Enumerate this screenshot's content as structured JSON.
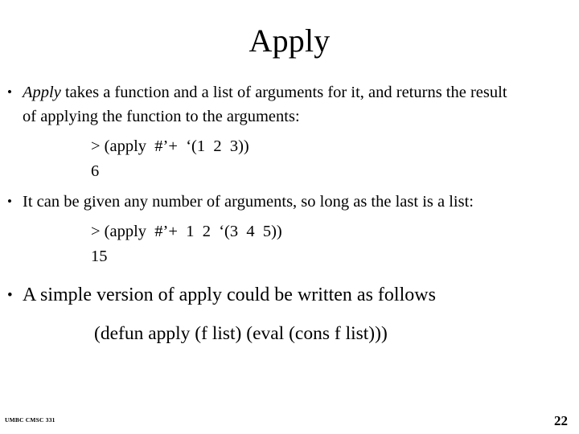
{
  "slide": {
    "title": "Apply",
    "bullets": [
      {
        "id": "bullet-apply-description",
        "lead_italic": "Apply",
        "text": " takes a function and a list of arguments for it, and returns the result of applying the function to the arguments:",
        "size": "normal"
      },
      {
        "id": "bullet-any-number-of-arguments",
        "lead_italic": "",
        "text": "It can be given any number of arguments, so long as the last is a list:",
        "size": "normal"
      },
      {
        "id": "bullet-simple-version",
        "lead_italic": "",
        "text": "A simple version of apply could be written as follows",
        "size": "big"
      }
    ],
    "code_blocks": [
      {
        "id": "repl-example-1",
        "prompt_line": "> (apply  #’+  ‘(1  2  3))",
        "result_line": "6"
      },
      {
        "id": "repl-example-2",
        "prompt_line": "> (apply  #’+  1  2  ‘(3  4  5))",
        "result_line": "15"
      }
    ],
    "defun_line": "(defun apply (f list) (eval (cons f list)))"
  },
  "footer": {
    "course": "UMBC CMSC 331",
    "page_number": "22"
  }
}
